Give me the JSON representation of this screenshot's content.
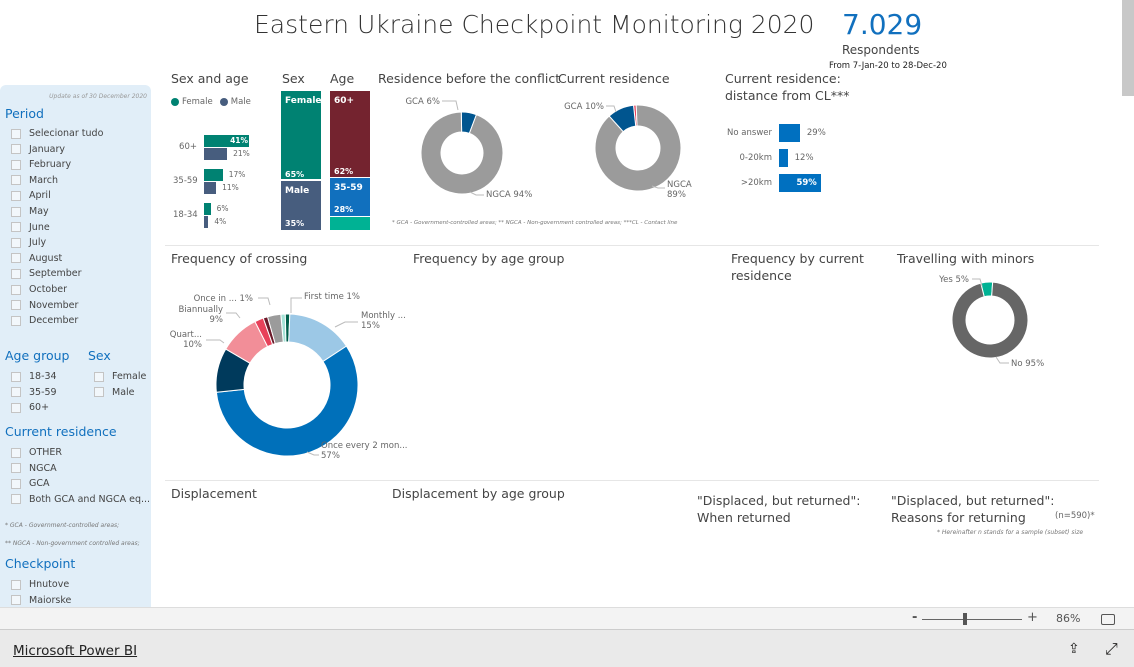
{
  "header": {
    "title": "Eastern Ukraine Checkpoint Monitoring 2020",
    "kpi_value": "7.029",
    "kpi_label": "Respondents",
    "date_range": "From 7-Jan-20 to 28-Dec-20"
  },
  "sidebar": {
    "update_note": "Update as of 30 December 2020",
    "period": {
      "title": "Period",
      "items": [
        "Selecionar tudo",
        "January",
        "February",
        "March",
        "April",
        "May",
        "June",
        "July",
        "August",
        "September",
        "October",
        "November",
        "December"
      ]
    },
    "age_group": {
      "title": "Age group",
      "items": [
        "18-34",
        "35-59",
        "60+"
      ]
    },
    "sex": {
      "title": "Sex",
      "items": [
        "Female",
        "Male"
      ]
    },
    "current_residence": {
      "title": "Current residence",
      "items": [
        "OTHER",
        "NGCA",
        "GCA",
        "Both GCA and NGCA eq..."
      ]
    },
    "note1": "* GCA - Government-controlled areas;",
    "note2": "** NGCA - Non-government controlled areas;",
    "checkpoint": {
      "title": "Checkpoint",
      "items": [
        "Hnutove",
        "Maiorske"
      ]
    }
  },
  "sections": {
    "sex_and_age": "Sex and age",
    "sex": "Sex",
    "age": "Age",
    "residence_before": "Residence before the conflict",
    "current_residence": "Current residence",
    "distance_title_1": "Current residence:",
    "distance_title_2": "distance from CL***",
    "footnote_top": "* GCA - Government-controlled areas; ** NGCA - Non-government controlled areas; ***CL - Contact line",
    "freq_crossing": "Frequency of crossing",
    "freq_age": "Frequency by age group",
    "freq_res_1": "Frequency by current",
    "freq_res_2": "residence",
    "minors": "Travelling with minors",
    "displacement": "Displacement",
    "displacement_age": "Displacement by age group",
    "dbr_when_1": "\"Displaced, but returned\":",
    "dbr_when_2": "When returned",
    "dbr_reasons_1": "\"Displaced, but returned\":",
    "dbr_reasons_2": "Reasons for returning",
    "n_note": "(n=590)*",
    "hereinafter": "* Hereinafter n stands for a sample (subset) size"
  },
  "colors": {
    "female": "#008272",
    "male": "#475d7e",
    "age60": "#74232f",
    "age35": "#1170be",
    "age18": "#00b294",
    "gca": "#00558f",
    "ngca": "#9b9b9b",
    "accent": "#1170be"
  },
  "chart_data": [
    {
      "type": "bar",
      "title": "Sex and age",
      "categories": [
        "60+",
        "35-59",
        "18-34"
      ],
      "series": [
        {
          "name": "Female",
          "values": [
            41,
            17,
            6
          ]
        },
        {
          "name": "Male",
          "values": [
            21,
            11,
            4
          ]
        }
      ],
      "legend": "top-left"
    },
    {
      "type": "bar",
      "title": "Sex",
      "categories": [
        "Female",
        "Male"
      ],
      "values": [
        65,
        35
      ],
      "stacked": true
    },
    {
      "type": "bar",
      "title": "Age",
      "categories": [
        "60+",
        "35-59",
        "18-34"
      ],
      "values": [
        62,
        28,
        10
      ],
      "labels": [
        "62%",
        "28%",
        ""
      ],
      "stacked": true
    },
    {
      "type": "pie",
      "title": "Residence before the conflict",
      "slices": [
        {
          "label": "GCA",
          "value": 6,
          "color": "#00558f"
        },
        {
          "label": "NGCA",
          "value": 94,
          "color": "#9b9b9b"
        }
      ]
    },
    {
      "type": "pie",
      "title": "Current residence",
      "slices": [
        {
          "label": "",
          "value": 1,
          "color": "#e8415a"
        },
        {
          "label": "NGCA",
          "value": 89,
          "color": "#9b9b9b"
        },
        {
          "label": "GCA",
          "value": 10,
          "color": "#00558f"
        }
      ]
    },
    {
      "type": "bar",
      "title": "Current residence: distance from CL***",
      "categories": [
        "No answer",
        "0-20km",
        ">20km"
      ],
      "values": [
        29,
        12,
        59
      ]
    },
    {
      "type": "pie",
      "title": "Frequency of crossing",
      "slices": [
        {
          "label": "First time",
          "value": 1,
          "color": "#a6e3d7"
        },
        {
          "label": "",
          "value": 1,
          "color": "#005f4b"
        },
        {
          "label": "Monthly ...",
          "value": 15,
          "color": "#9cc8e6"
        },
        {
          "label": "Once every 2 mon...",
          "value": 57,
          "color": "#0070ba"
        },
        {
          "label": "Quart...",
          "value": 10,
          "color": "#003a5c"
        },
        {
          "label": "Biannually",
          "value": 9,
          "color": "#f28e98"
        },
        {
          "label": "",
          "value": 2,
          "color": "#e8415a"
        },
        {
          "label": "Once in ...",
          "value": 1,
          "color": "#6b1a2a"
        },
        {
          "label": "",
          "value": 3,
          "color": "#9b9b9b"
        }
      ]
    },
    {
      "type": "pie",
      "title": "Travelling with minors",
      "slices": [
        {
          "label": "Yes",
          "value": 5,
          "color": "#00b294"
        },
        {
          "label": "No",
          "value": 95,
          "color": "#666666"
        }
      ]
    }
  ],
  "zoom": {
    "minus": "-",
    "plus": "+",
    "level": "86%",
    "slider_value": 86
  },
  "footer": {
    "brand": "Microsoft Power BI"
  }
}
